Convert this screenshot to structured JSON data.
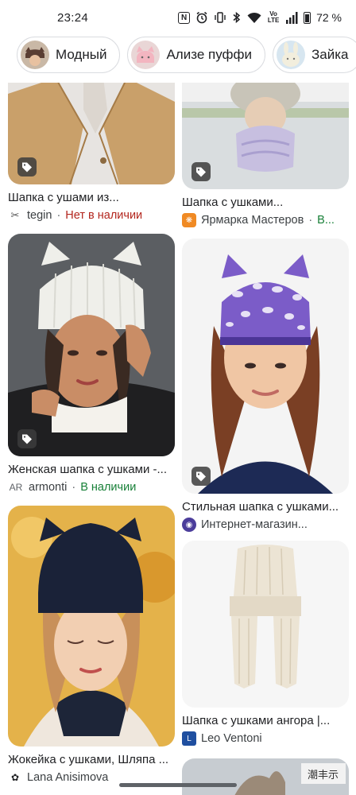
{
  "status_bar": {
    "time": "23:24",
    "battery_text": "72 %",
    "icons": [
      "nfc-icon",
      "alarm-icon",
      "vibrate-icon",
      "bluetooth-icon",
      "wifi-icon",
      "volte-icon",
      "signal-icon",
      "battery-icon"
    ],
    "volte_label": "Vo LTE"
  },
  "chips": [
    {
      "label": "Модный",
      "icon": "hat-thumbnail"
    },
    {
      "label": "Ализе пуффи",
      "icon": "hat-thumbnail"
    },
    {
      "label": "Зайка",
      "icon": "hat-thumbnail"
    }
  ],
  "cards": [
    {
      "title": "Шапка с ушами из...",
      "source": "tegin",
      "separator": "·",
      "availability": "Нет в наличии",
      "favicon": "tegin-icon"
    },
    {
      "title": "Шапка с ушками...",
      "source": "Ярмарка Мастеров",
      "separator": "·",
      "availability": "В...",
      "favicon": "livemaster-icon"
    },
    {
      "title": "Женская шапка с ушками -...",
      "source": "armonti",
      "separator": "·",
      "availability": "В наличии",
      "favicon": "armonti-icon"
    },
    {
      "title": "Стильная шапка с ушками...",
      "source": "Интернет-магазин...",
      "separator": "",
      "availability": "",
      "favicon": "shop-icon"
    },
    {
      "title": "Жокейка с ушками, Шляпа ...",
      "source": "Lana Anisimova",
      "separator": "",
      "availability": "",
      "favicon": "lana-icon"
    },
    {
      "title": "Шапка с ушками ангора |...",
      "source": "Leo Ventoni",
      "separator": "",
      "availability": "",
      "favicon": "leo-ventoni-icon"
    }
  ],
  "partial_card_text": "潮丰示",
  "colors": {
    "out_of_stock": "#b3261e",
    "in_stock": "#188038"
  }
}
